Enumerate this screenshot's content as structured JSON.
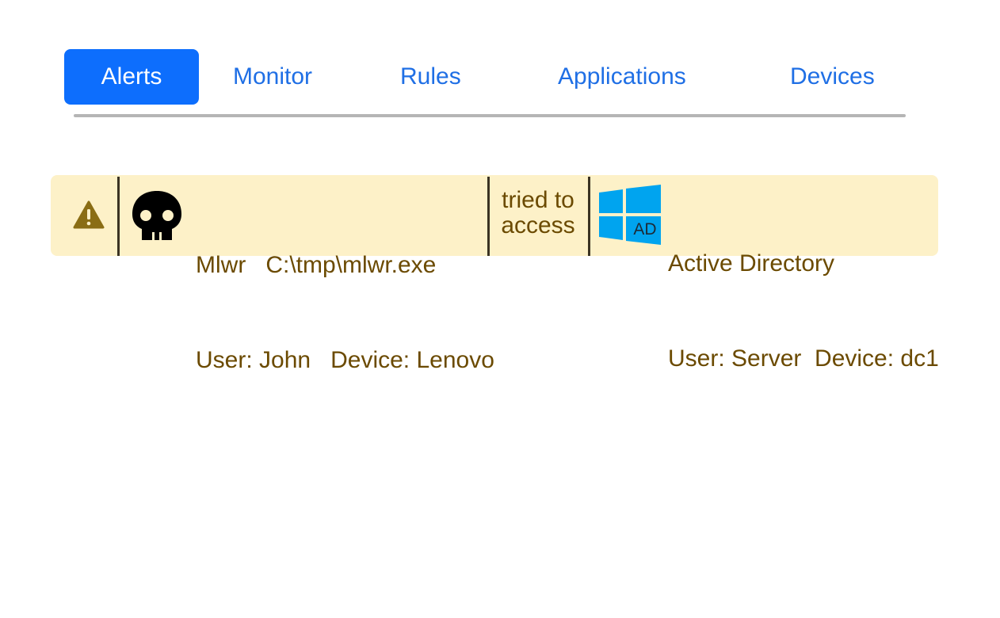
{
  "tabs": [
    {
      "label": "Alerts",
      "active": true
    },
    {
      "label": "Monitor",
      "active": false
    },
    {
      "label": "Rules",
      "active": false
    },
    {
      "label": "Applications",
      "active": false
    },
    {
      "label": "Devices",
      "active": false
    }
  ],
  "alert": {
    "severity_icon": "warning-triangle-icon",
    "source": {
      "icon": "skull-icon",
      "name": "Mlwr",
      "path": "C:\\tmp\\mlwr.exe",
      "user_label": "User: John",
      "device_label": "Device: Lenovo"
    },
    "action_line1": "tried to",
    "action_line2": "access",
    "target": {
      "icon": "windows-icon",
      "icon_text": "AD",
      "name": "Active Directory",
      "user_label": "User: Server",
      "device_label": "Device: dc1"
    }
  },
  "colors": {
    "accent": "#0d6efd",
    "tab_text": "#1f6fe5",
    "alert_bg": "#fdf1c8",
    "alert_text": "#6b4a00",
    "windows_blue": "#00a4ef"
  }
}
